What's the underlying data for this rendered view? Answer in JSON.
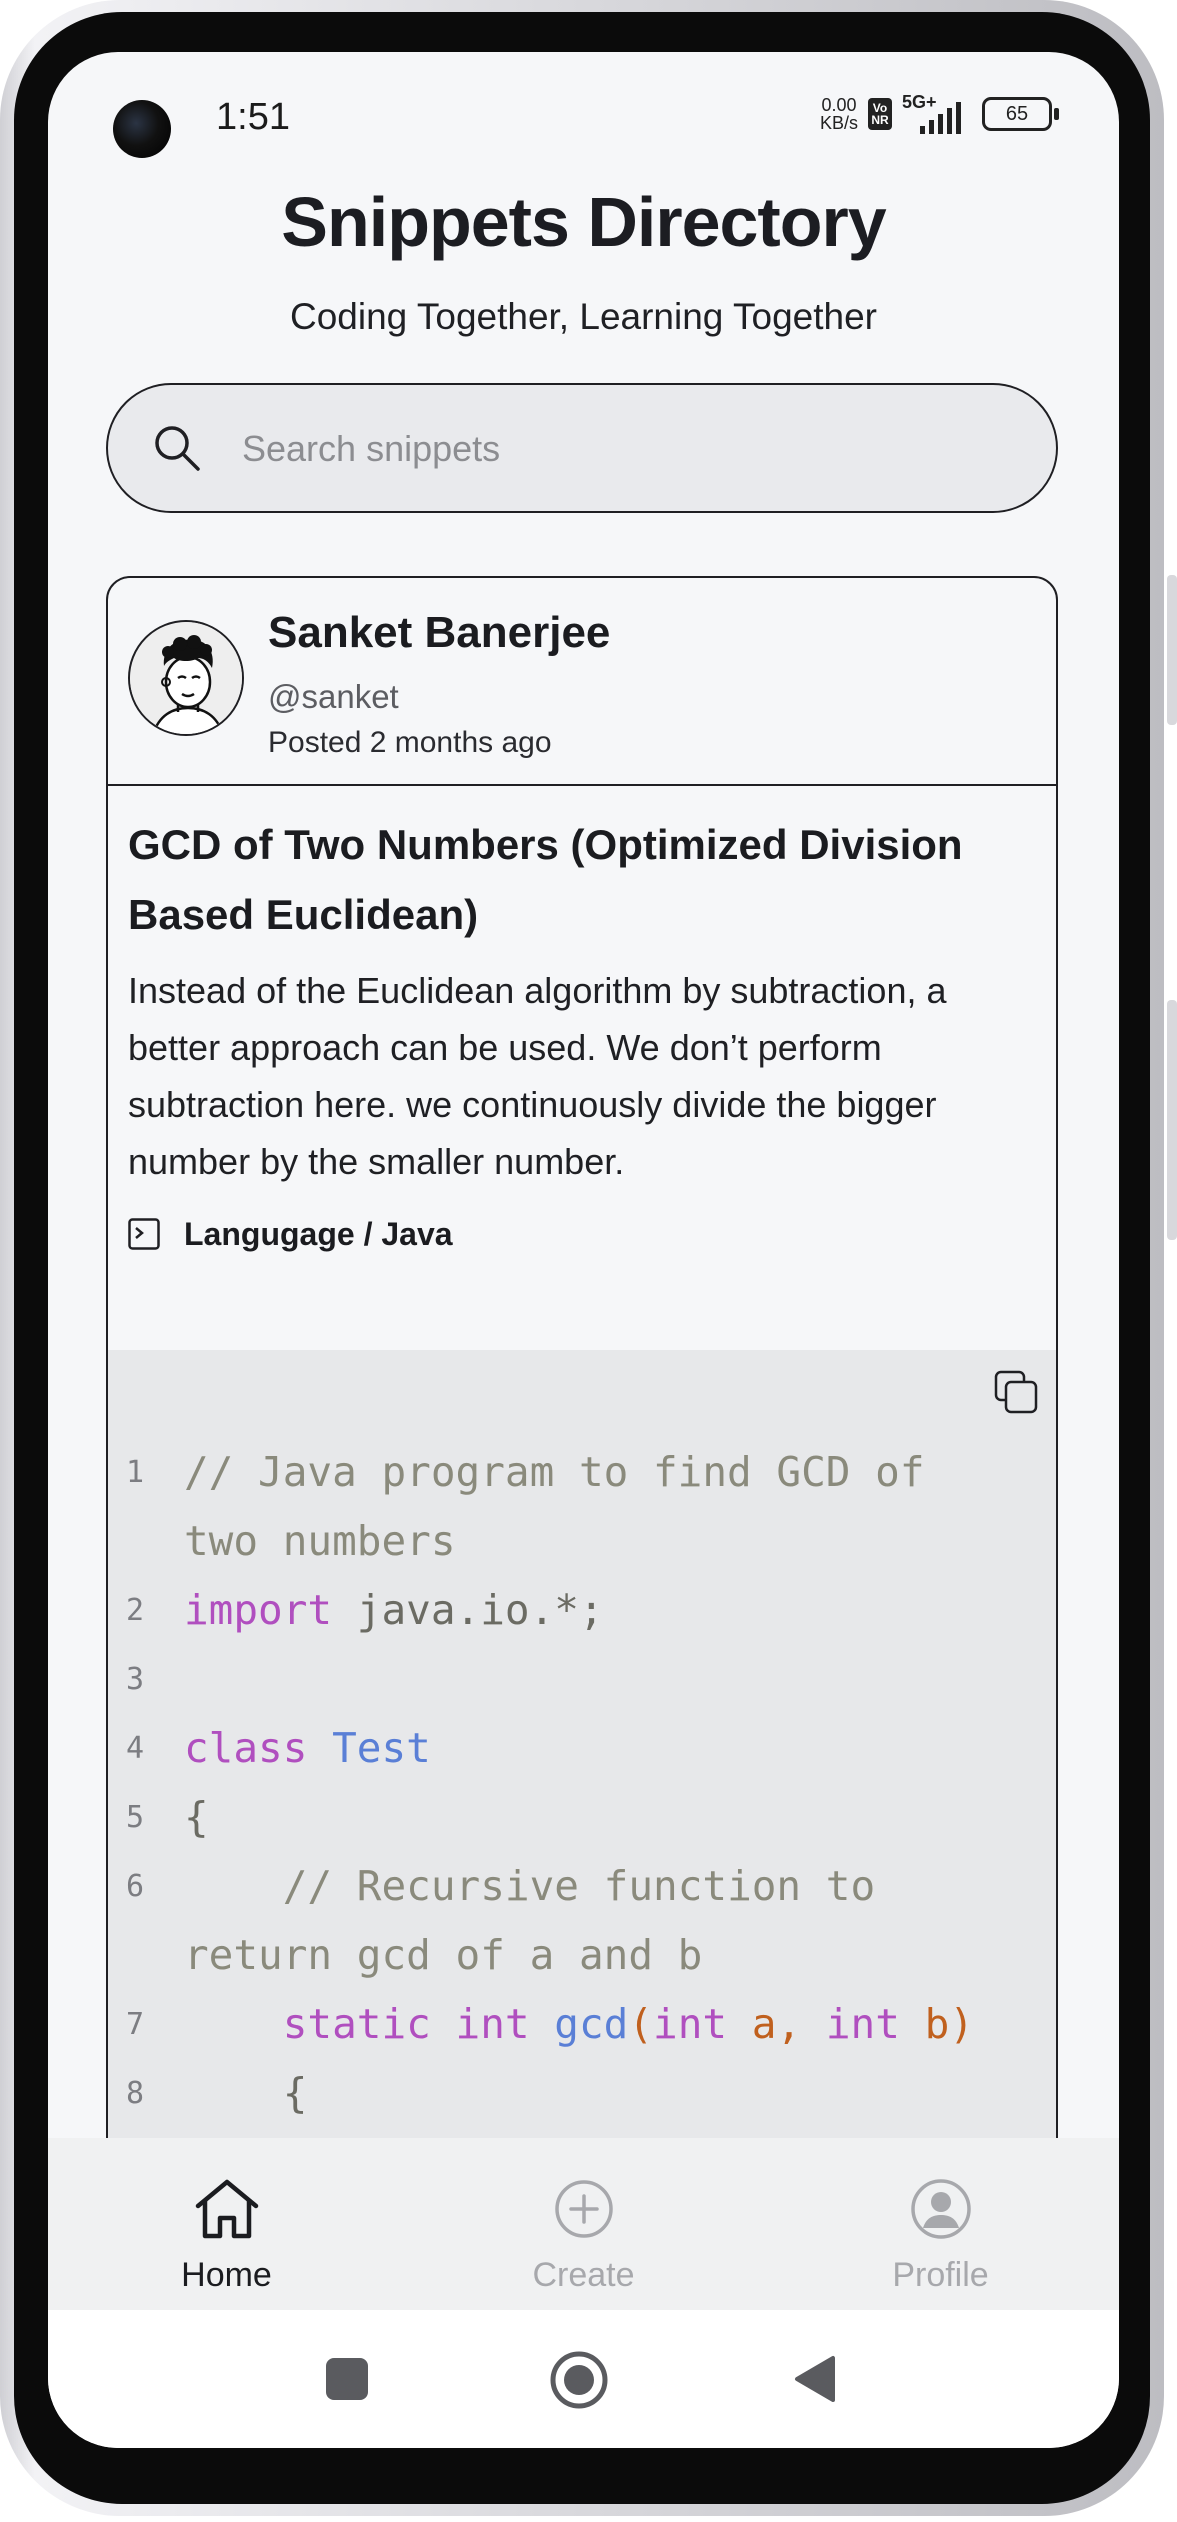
{
  "status_bar": {
    "time": "1:51",
    "net_speed_value": "0.00",
    "net_speed_unit": "KB/s",
    "volte_badge": "Vo NR",
    "network_type": "5G+",
    "battery_level": "65"
  },
  "header": {
    "title": "Snippets Directory",
    "subtitle": "Coding Together, Learning Together"
  },
  "search": {
    "placeholder": "Search snippets",
    "value": ""
  },
  "snippet": {
    "author": {
      "name": "Sanket Banerjee",
      "handle": "@sanket",
      "posted": "Posted 2 months ago"
    },
    "title": "GCD of Two Numbers (Optimized Division Based Euclidean)",
    "description": "Instead of the Euclidean algorithm by subtraction, a better approach can be used. We don’t perform subtraction here. we continuously divide the bigger number by the smaller number.",
    "language_label": "Langugage / Java",
    "code_lines": [
      {
        "number": "1",
        "tokens": [
          {
            "text": "// Java program to find GCD of two numbers",
            "type": "com"
          }
        ]
      },
      {
        "number": "2",
        "tokens": [
          {
            "text": "import",
            "type": "kw"
          },
          {
            "text": " java.io.*;",
            "type": "pl"
          }
        ]
      },
      {
        "number": "3",
        "tokens": [
          {
            "text": "",
            "type": "pl"
          }
        ]
      },
      {
        "number": "4",
        "tokens": [
          {
            "text": "class",
            "type": "kw"
          },
          {
            "text": " ",
            "type": "pl"
          },
          {
            "text": "Test",
            "type": "cls"
          }
        ]
      },
      {
        "number": "5",
        "tokens": [
          {
            "text": "{",
            "type": "pl"
          }
        ]
      },
      {
        "number": "6",
        "tokens": [
          {
            "text": "    // Recursive function to return gcd of a and b",
            "type": "com"
          }
        ]
      },
      {
        "number": "7",
        "tokens": [
          {
            "text": "    ",
            "type": "pl"
          },
          {
            "text": "static",
            "type": "kw"
          },
          {
            "text": " ",
            "type": "pl"
          },
          {
            "text": "int",
            "type": "kw"
          },
          {
            "text": " ",
            "type": "pl"
          },
          {
            "text": "gcd",
            "type": "fn"
          },
          {
            "text": "(",
            "type": "var"
          },
          {
            "text": "int",
            "type": "kw"
          },
          {
            "text": " a, ",
            "type": "var"
          },
          {
            "text": "int",
            "type": "kw"
          },
          {
            "text": " b)",
            "type": "var"
          }
        ]
      },
      {
        "number": "8",
        "tokens": [
          {
            "text": "    {",
            "type": "pl"
          }
        ]
      }
    ]
  },
  "bottom_nav": {
    "items": [
      {
        "label": "Home",
        "icon": "home-icon",
        "active": true
      },
      {
        "label": "Create",
        "icon": "plus-circle-icon",
        "active": false
      },
      {
        "label": "Profile",
        "icon": "profile-icon",
        "active": false
      }
    ]
  },
  "colors": {
    "keyword": "#b04fbf",
    "class_name": "#5a7fd6",
    "variable": "#c0601e",
    "comment": "#8a8a7c",
    "inactive_nav": "#a7a8ac"
  }
}
